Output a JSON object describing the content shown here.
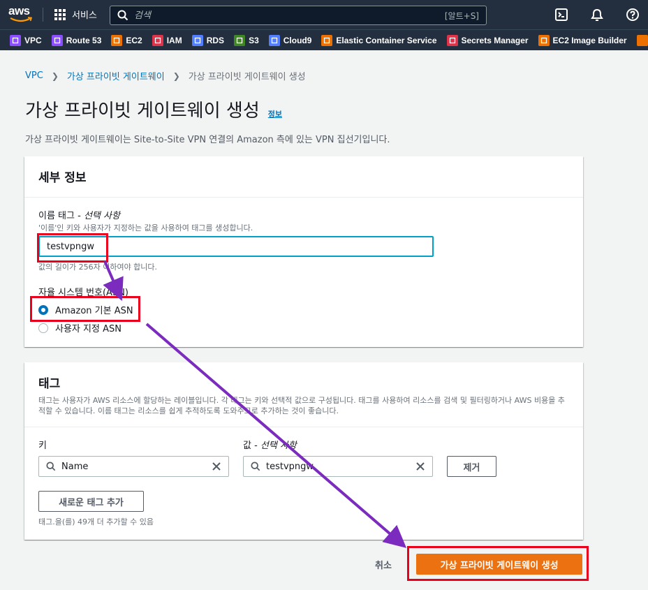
{
  "nav": {
    "logo_text": "aws",
    "services_label": "서비스",
    "search_placeholder": "검색",
    "search_shortcut": "[알트+S]"
  },
  "favorites": [
    {
      "label": "VPC",
      "color": "#8c4fff",
      "icon": "vpc-icon"
    },
    {
      "label": "Route 53",
      "color": "#8c4fff",
      "icon": "route53-icon"
    },
    {
      "label": "EC2",
      "color": "#ed7100",
      "icon": "ec2-icon"
    },
    {
      "label": "IAM",
      "color": "#dd344c",
      "icon": "iam-icon"
    },
    {
      "label": "RDS",
      "color": "#527fff",
      "icon": "rds-icon"
    },
    {
      "label": "S3",
      "color": "#3f8624",
      "icon": "s3-icon"
    },
    {
      "label": "Cloud9",
      "color": "#527fff",
      "icon": "cloud9-icon"
    },
    {
      "label": "Elastic Container Service",
      "color": "#ed7100",
      "icon": "ecs-icon"
    },
    {
      "label": "Secrets Manager",
      "color": "#dd344c",
      "icon": "secrets-manager-icon"
    },
    {
      "label": "EC2 Image Builder",
      "color": "#ed7100",
      "icon": "image-builder-icon"
    }
  ],
  "breadcrumb": {
    "items": [
      "VPC",
      "가상 프라이빗 게이트웨이"
    ],
    "current": "가상 프라이빗 게이트웨이 생성"
  },
  "page": {
    "title": "가상 프라이빗 게이트웨이 생성",
    "info": "정보",
    "description": "가상 프라이빗 게이트웨이는 Site-to-Site VPN 연결의 Amazon 측에 있는 VPN 집선기입니다."
  },
  "details": {
    "heading": "세부 정보",
    "name_label": "이름 태그 - ",
    "name_label_optional": "선택 사항",
    "name_hint": "'이름'인 키와 사용자가 지정하는 값을 사용하여 태그를 생성합니다.",
    "name_value": "testvpngw",
    "name_constraint": "값의 길이가 256자 이하여야 합니다.",
    "asn_label": "자율 시스템 번호(ASN)",
    "asn_options": [
      "Amazon 기본 ASN",
      "사용자 지정 ASN"
    ],
    "asn_selected": "Amazon 기본 ASN"
  },
  "tags": {
    "heading": "태그",
    "description": "태그는 사용자가 AWS 리소스에 할당하는 레이블입니다. 각 태그는 키와 선택적 값으로 구성됩니다. 태그를 사용하여 리소스를 검색 및 필터링하거나 AWS 비용을 추적할 수 있습니다. 이름 태그는 리소스를 쉽게 추적하도록 도와주므로 추가하는 것이 좋습니다.",
    "key_label": "키",
    "value_label": "값 - ",
    "value_label_optional": "선택 사항",
    "key_value": "Name",
    "value_value": "testvpngw",
    "remove_label": "제거",
    "add_label": "새로운 태그 추가",
    "remaining": "태그.을(를) 49개 더 추가할 수 있음"
  },
  "footer": {
    "cancel": "취소",
    "submit": "가상 프라이빗 게이트웨이 생성"
  },
  "annotation": {
    "highlight_color": "#e8001c",
    "arrow_color": "#7b2cbf"
  }
}
